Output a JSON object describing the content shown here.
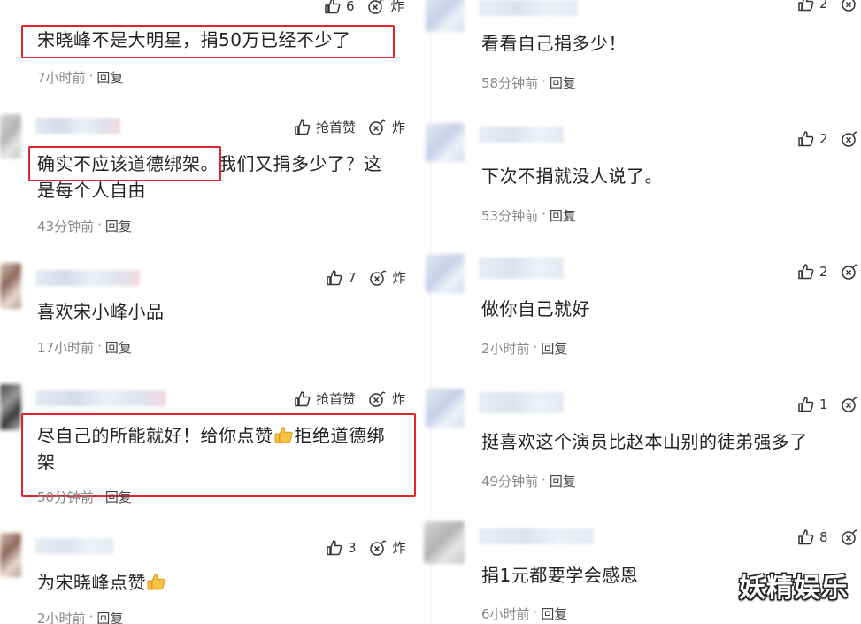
{
  "left": [
    {
      "text": "宋晓峰不是大明星，捐50万已经不少了",
      "time": "7小时前",
      "reply": "回复",
      "like_label": "6",
      "fire_label": "炸"
    },
    {
      "text": "确实不应该道德绑架。我们又捐多少了？这是每个人自由",
      "line1": "确实不应该道德绑架。我们又捐多少了？这",
      "line2": "是每个人自由",
      "time": "43分钟前",
      "reply": "回复",
      "like_label": "抢首赞",
      "fire_label": "炸"
    },
    {
      "text": "喜欢宋小峰小品",
      "time": "17小时前",
      "reply": "回复",
      "like_label": "7",
      "fire_label": "炸"
    },
    {
      "line1": "尽自己的所能就好！给你点赞",
      "line1b": "拒绝道德绑",
      "line2": "架",
      "time": "50分钟前",
      "reply": "回复",
      "like_label": "抢首赞",
      "fire_label": "炸"
    },
    {
      "text": "为宋晓峰点赞",
      "time": "2小时前",
      "reply": "回复",
      "like_label": "3",
      "fire_label": "炸"
    }
  ],
  "right": [
    {
      "text": "看看自己捐多少！",
      "time": "58分钟前",
      "reply": "回复",
      "like_label": "2"
    },
    {
      "text": "下次不捐就没人说了。",
      "time": "53分钟前",
      "reply": "回复",
      "like_label": "2"
    },
    {
      "text": "做你自己就好",
      "time": "2小时前",
      "reply": "回复",
      "like_label": "2"
    },
    {
      "text": "挺喜欢这个演员比赵本山别的徒弟强多了",
      "time": "49分钟前",
      "reply": "回复",
      "like_label": "1"
    },
    {
      "text": "捐1元都要学会感恩",
      "time": "6小时前",
      "reply": "回复",
      "like_label": "8"
    }
  ],
  "watermark": "妖精娱乐",
  "icons": {
    "like": "thumbs-up-icon",
    "fire": "bomb-icon",
    "emoji": "thumbs-up-emoji"
  },
  "colors": {
    "highlight": "#e0262b",
    "meta": "#888888"
  }
}
